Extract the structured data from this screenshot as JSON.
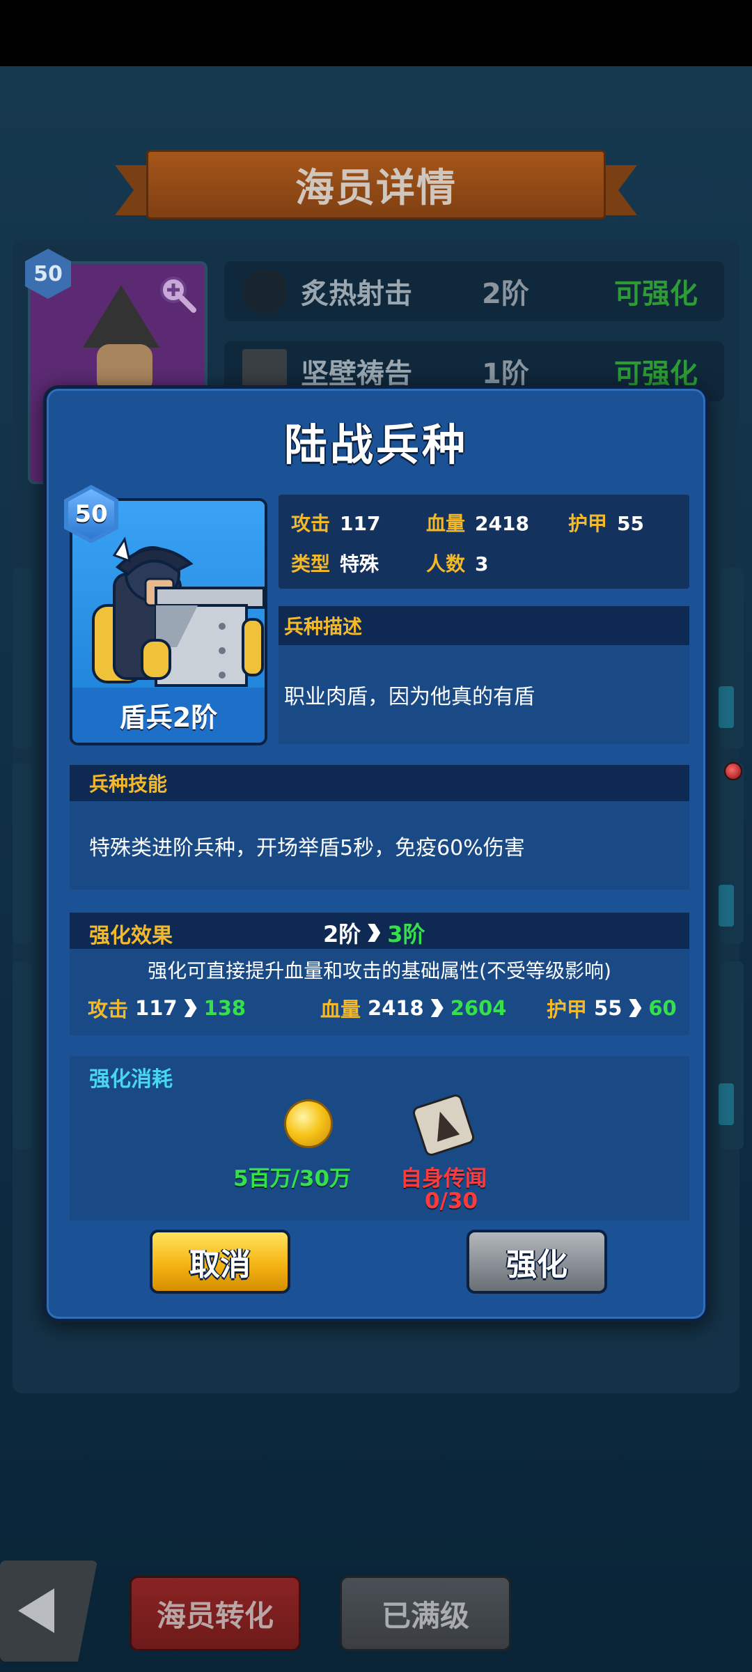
{
  "background": {
    "title": "海员详情",
    "portrait_level": "50",
    "skills": [
      {
        "name": "炙热射击",
        "level": "2阶",
        "status": "可强化"
      },
      {
        "name": "坚壁祷告",
        "level": "1阶",
        "status": "可强化"
      }
    ],
    "bottom": {
      "convert_label": "海员转化",
      "maxed_label": "已满级"
    }
  },
  "modal": {
    "title": "陆战兵种",
    "unit": {
      "level": "50",
      "name": "盾兵2阶"
    },
    "stats": {
      "attack_label": "攻击",
      "attack": "117",
      "hp_label": "血量",
      "hp": "2418",
      "armor_label": "护甲",
      "armor": "55",
      "type_label": "类型",
      "type": "特殊",
      "count_label": "人数",
      "count": "3"
    },
    "description": {
      "header": "兵种描述",
      "text": "职业肉盾，因为他真的有盾"
    },
    "skill": {
      "header": "兵种技能",
      "text": "特殊类进阶兵种，开场举盾5秒，免疫60%伤害"
    },
    "upgrade": {
      "header": "强化效果",
      "from_tier": "2阶",
      "to_tier": "3阶",
      "note": "强化可直接提升血量和攻击的基础属性(不受等级影响)",
      "attack_label": "攻击",
      "attack_from": "117",
      "attack_to": "138",
      "hp_label": "血量",
      "hp_from": "2418",
      "hp_to": "2604",
      "armor_label": "护甲",
      "armor_from": "55",
      "armor_to": "60"
    },
    "cost": {
      "header": "强化消耗",
      "coin_amount": "5百万/30万",
      "fragment_name": "自身传闻",
      "fragment_count": "0/30"
    },
    "buttons": {
      "cancel": "取消",
      "upgrade": "强化"
    }
  },
  "colors": {
    "accent_yellow": "#f4b92a",
    "increase_green": "#35e04a",
    "insufficient_red": "#ff3a3a",
    "cost_title_cyan": "#48d6f0"
  }
}
